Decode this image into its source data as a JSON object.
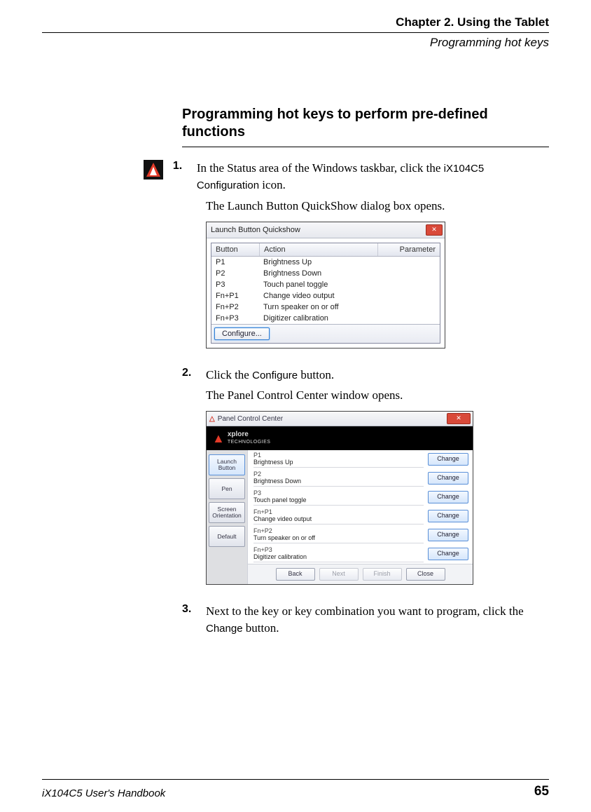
{
  "header": {
    "chapter": "Chapter 2. Using the Tablet",
    "section": "Programming hot keys"
  },
  "section_title": "Programming hot keys to perform pre-defined functions",
  "steps": {
    "s1": {
      "num": "1.",
      "pre": "In the Status area of the Windows taskbar, click the ",
      "san1": "iX104C5 Configuration",
      "post": " icon.",
      "follow": "The Launch Button QuickShow dialog box opens."
    },
    "s2": {
      "num": "2.",
      "pre": "Click the ",
      "san1": "Configure",
      "post": " button.",
      "follow": "The Panel Control Center window opens."
    },
    "s3": {
      "num": "3.",
      "pre": "Next to the key or key combination you want to program, click the ",
      "san1": "Change",
      "post": " button."
    }
  },
  "quickshow": {
    "title": "Launch Button Quickshow",
    "headers": {
      "button": "Button",
      "action": "Action",
      "parameter": "Parameter"
    },
    "rows": [
      {
        "b": "P1",
        "a": "Brightness Up"
      },
      {
        "b": "P2",
        "a": "Brightness Down"
      },
      {
        "b": "P3",
        "a": "Touch panel toggle"
      },
      {
        "b": "Fn+P1",
        "a": "Change video output"
      },
      {
        "b": "Fn+P2",
        "a": "Turn speaker on or off"
      },
      {
        "b": "Fn+P3",
        "a": "Digitizer calibration"
      }
    ],
    "configure": "Configure..."
  },
  "pcc": {
    "title": "Panel Control Center",
    "brand_top": "xplore",
    "brand_bot": "TECHNOLOGIES",
    "tabs": {
      "launch": "Launch Button",
      "pen": "Pen",
      "orient": "Screen Orientation",
      "default": "Default"
    },
    "rows": [
      {
        "a": "P1",
        "b": "Brightness Up"
      },
      {
        "a": "P2",
        "b": "Brightness Down"
      },
      {
        "a": "P3",
        "b": "Touch panel toggle"
      },
      {
        "a": "Fn+P1",
        "b": "Change video output"
      },
      {
        "a": "Fn+P2",
        "b": "Turn speaker on or off"
      },
      {
        "a": "Fn+P3",
        "b": "Digitizer calibration"
      }
    ],
    "change": "Change",
    "buttons": {
      "back": "Back",
      "next": "Next",
      "finish": "Finish",
      "close": "Close"
    }
  },
  "footer": {
    "book": "iX104C5 User's Handbook",
    "page": "65"
  }
}
